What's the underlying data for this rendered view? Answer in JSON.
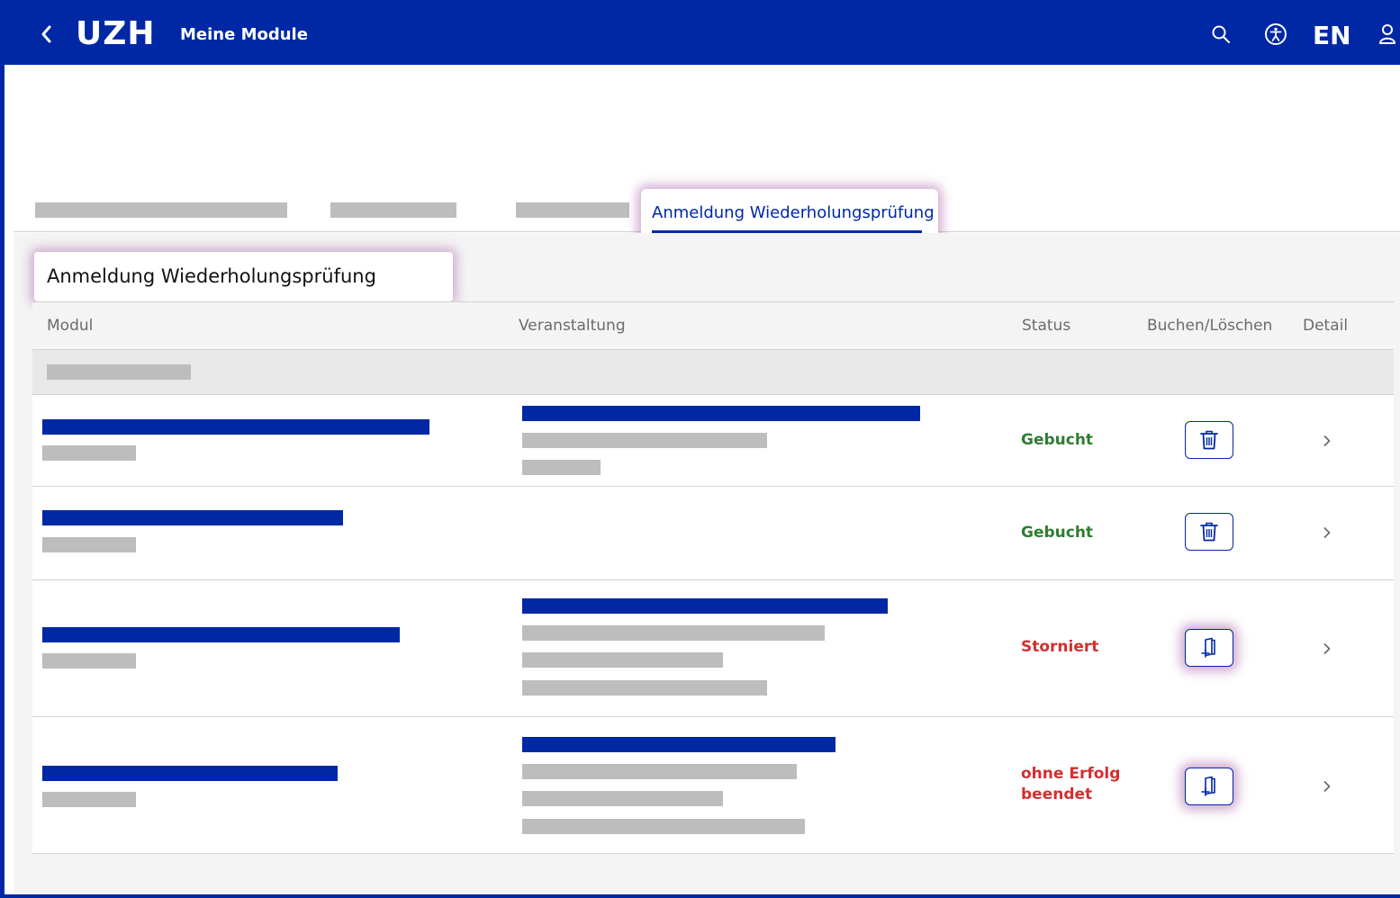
{
  "header": {
    "logo": "UZH",
    "title": "Meine Module",
    "language": "EN",
    "icons": [
      "back-chevron-icon",
      "search-icon",
      "accessibility-icon",
      "user-icon"
    ]
  },
  "tabs": {
    "active_label": "Anmeldung Wiederholungsprüfung",
    "redacted_count": 3
  },
  "section": {
    "title": "Anmeldung Wiederholungsprüfung"
  },
  "table": {
    "columns": [
      "Modul",
      "Veranstaltung",
      "Status",
      "Buchen/Löschen",
      "Detail"
    ],
    "rows": [
      {
        "status": "Gebucht",
        "status_color": "#2e7d32",
        "action": "delete",
        "action_icon": "trash-icon",
        "highlighted": false
      },
      {
        "status": "Gebucht",
        "status_color": "#2e7d32",
        "action": "delete",
        "action_icon": "trash-icon",
        "highlighted": false
      },
      {
        "status": "Storniert",
        "status_color": "#d32f2f",
        "action": "book",
        "action_icon": "book-add-icon",
        "highlighted": true
      },
      {
        "status": "ohne Erfolg beendet",
        "status_color": "#d32f2f",
        "action": "book",
        "action_icon": "book-add-icon",
        "highlighted": true
      }
    ]
  },
  "colors": {
    "brand": "#0028a5",
    "redacted": "#bdbdbd",
    "success": "#2e7d32",
    "error": "#d32f2f"
  }
}
